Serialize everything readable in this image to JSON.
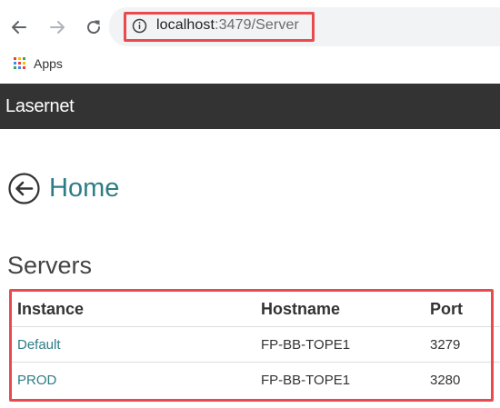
{
  "browser": {
    "url_host": "localhost",
    "url_rest": ":3479/Server",
    "bookmarks": [
      {
        "label": "Apps"
      }
    ]
  },
  "navbar": {
    "brand": "Lasernet"
  },
  "page": {
    "home_link_label": "Home",
    "section_title": "Servers"
  },
  "table": {
    "headers": [
      "Instance",
      "Hostname",
      "Port"
    ],
    "rows": [
      {
        "instance": "Default",
        "hostname": "FP-BB-TOPE1",
        "port": "3279"
      },
      {
        "instance": "PROD",
        "hostname": "FP-BB-TOPE1",
        "port": "3280"
      }
    ]
  },
  "colors": {
    "navbar_bg": "#333333",
    "link": "#2e7d86",
    "highlight": "#e84b4f",
    "omnibox_bg": "#f1f3f4"
  }
}
